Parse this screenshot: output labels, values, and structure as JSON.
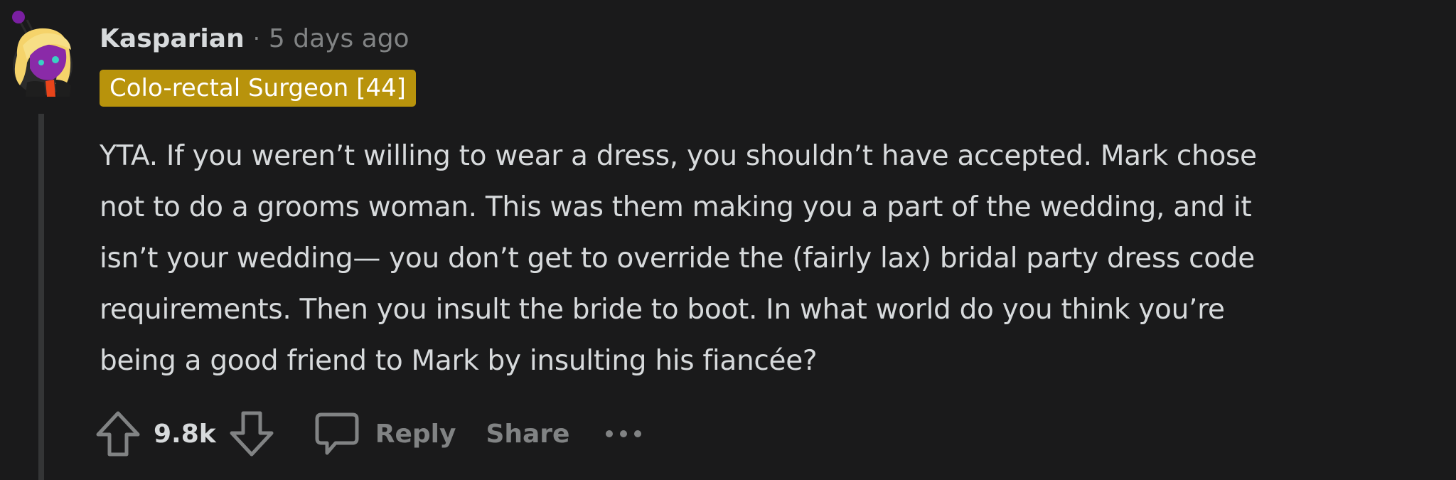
{
  "comment": {
    "author": "Kasparian",
    "separator": "·",
    "timestamp": "5 days ago",
    "flair": "Colo-rectal Surgeon [44]",
    "body": [
      "YTA. If you weren’t willing to wear a dress, you shouldn’t have accepted. Mark chose",
      "not to do a grooms woman. This was them making you a part of the wedding, and it",
      "isn’t your wedding— you don’t get to override the (fairly lax) bridal party dress code",
      "requirements. Then you insult the bride to boot. In what world do you think you’re",
      "being a good friend to Mark by insulting his fiancée?"
    ]
  },
  "actions": {
    "score": "9.8k",
    "reply_label": "Reply",
    "share_label": "Share",
    "more_icon": "more-horizontal-icon",
    "upvote_icon": "upvote-arrow-icon",
    "downvote_icon": "downvote-arrow-icon",
    "reply_icon": "speech-bubble-icon"
  },
  "colors": {
    "background": "#1a1a1b",
    "text": "#d7dadc",
    "muted": "#818384",
    "flair_bg": "#b8930c",
    "thread_line": "#343536"
  }
}
